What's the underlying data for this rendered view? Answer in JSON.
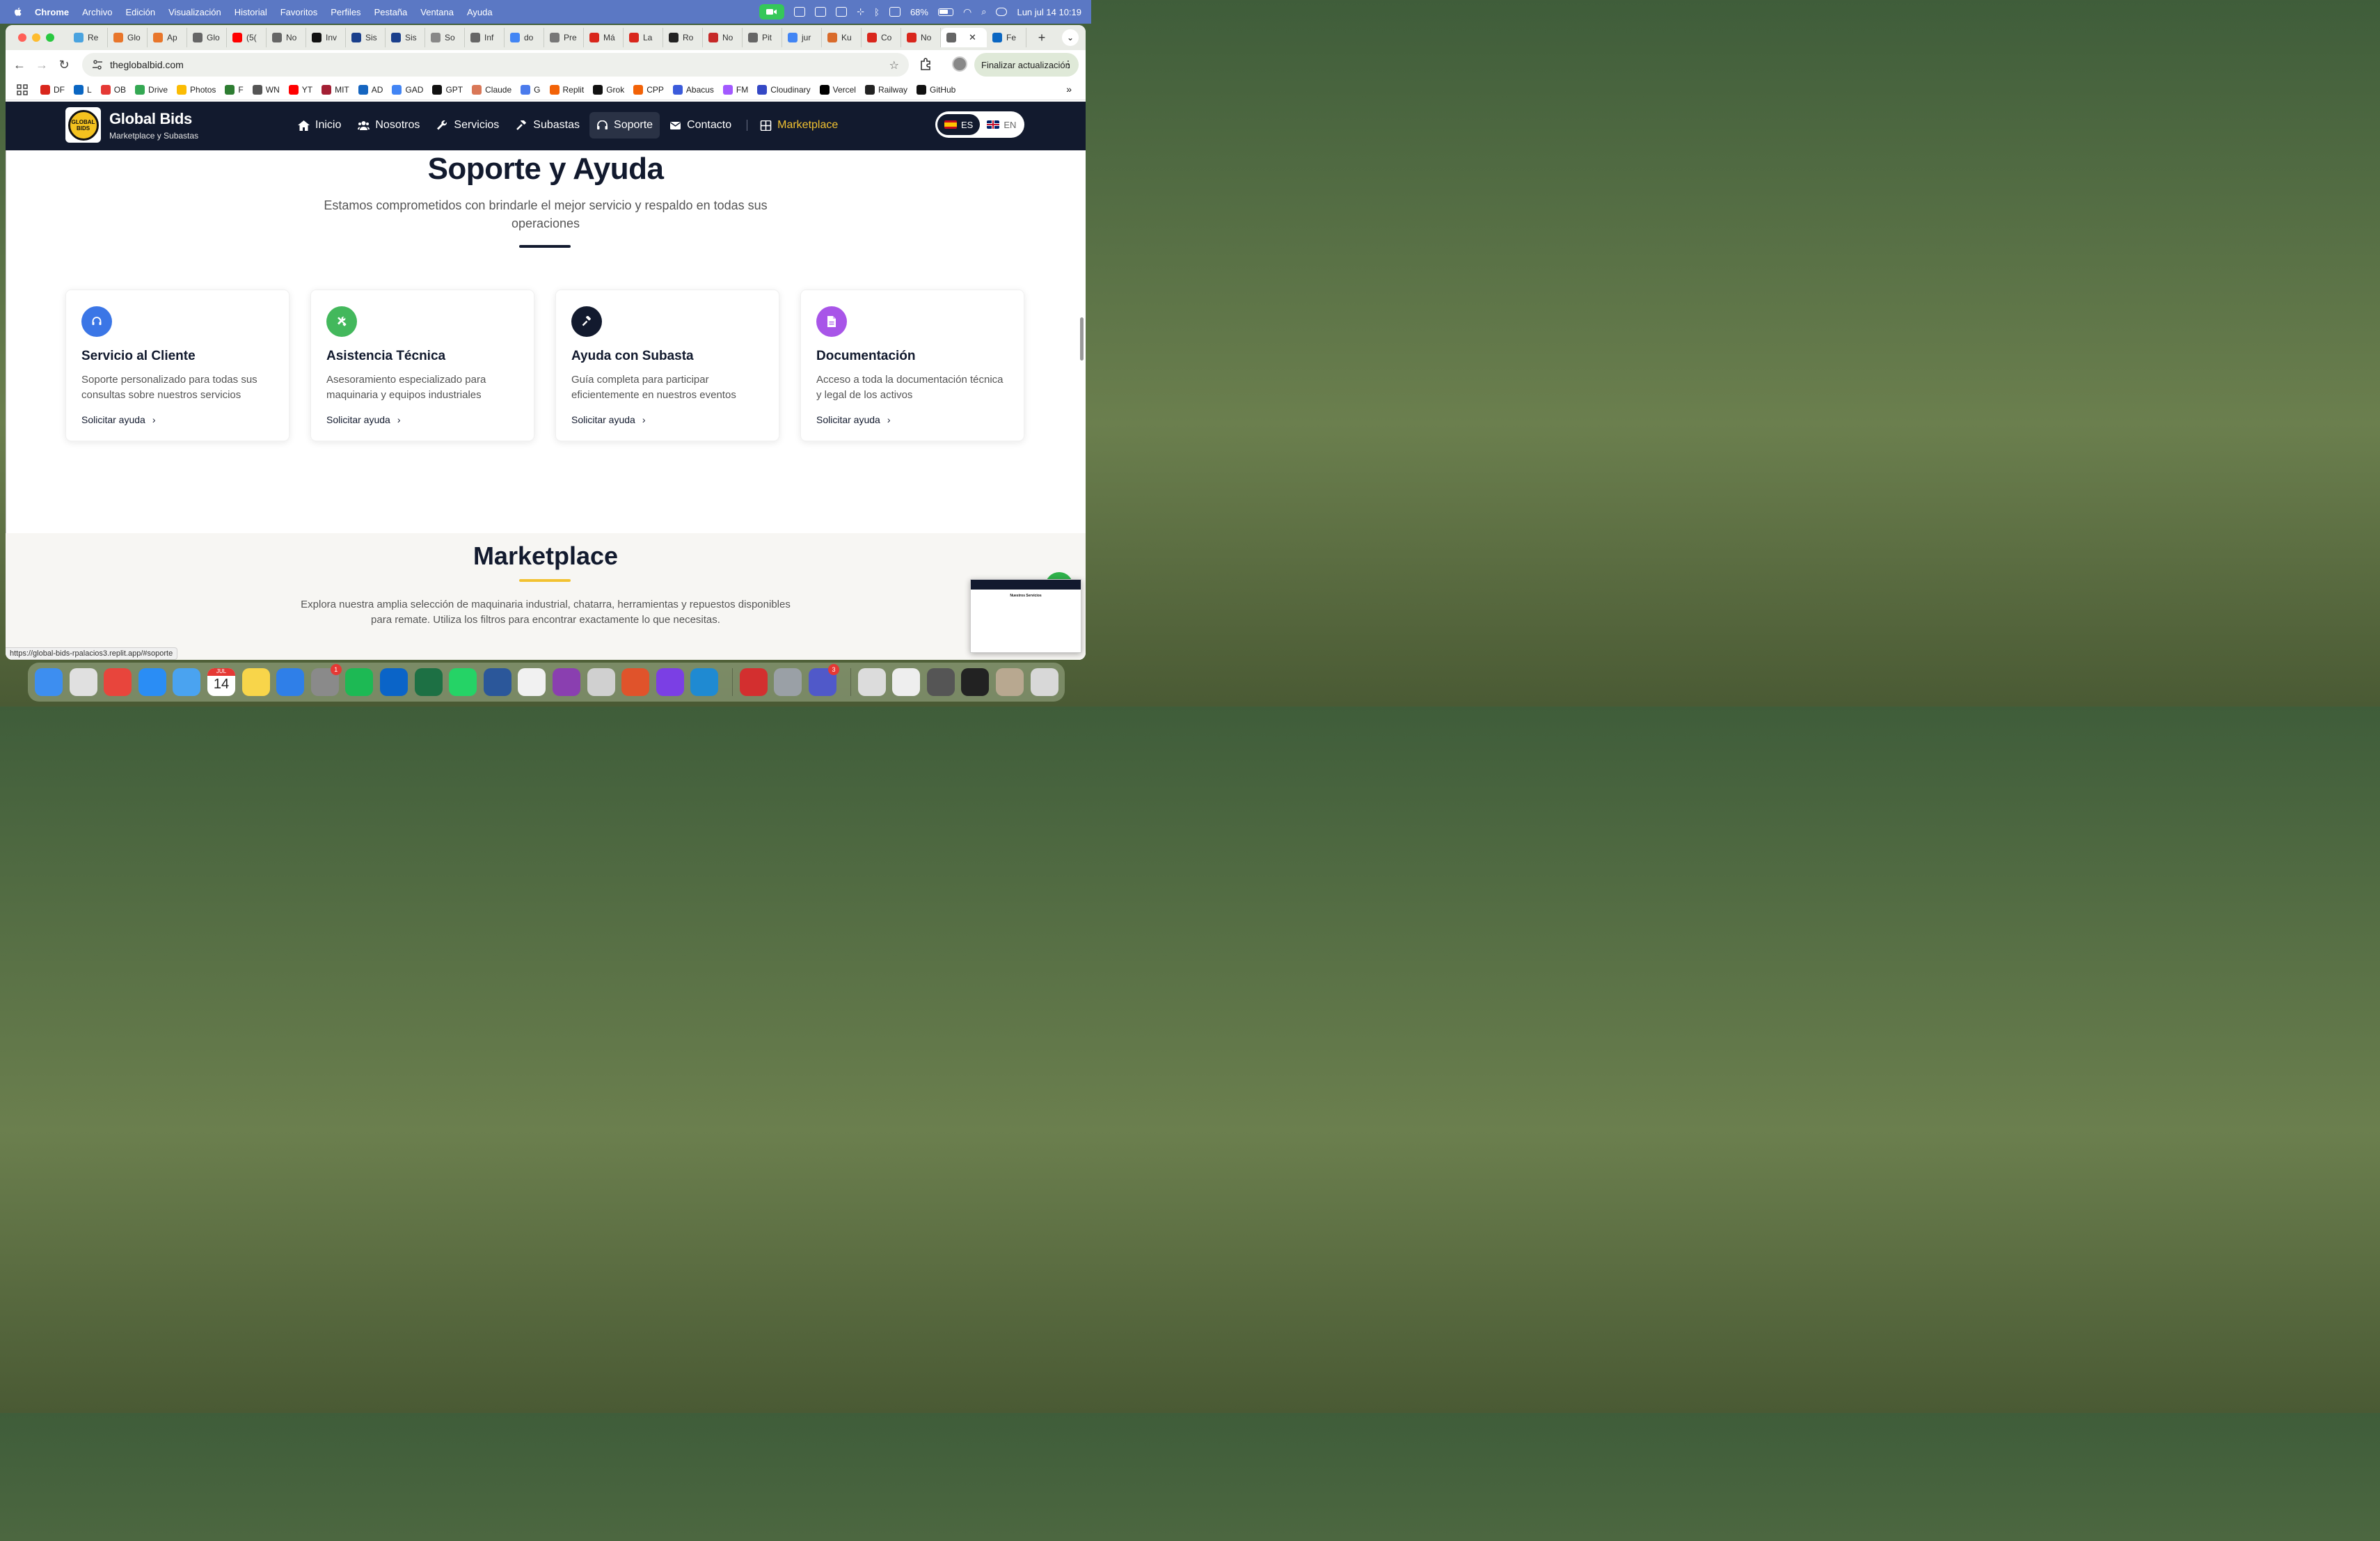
{
  "menubar": {
    "app": "Chrome",
    "items": [
      "Archivo",
      "Edición",
      "Visualización",
      "Historial",
      "Favoritos",
      "Perfiles",
      "Pestaña",
      "Ventana",
      "Ayuda"
    ],
    "battery": "68%",
    "datetime": "Lun jul 14  10:19"
  },
  "tabs": [
    {
      "label": "Re",
      "color": "#4aa3df"
    },
    {
      "label": "Glo",
      "color": "#e8762b"
    },
    {
      "label": "Ap",
      "color": "#e8762b"
    },
    {
      "label": "Glo",
      "color": "#666"
    },
    {
      "label": "(5(",
      "color": "#ff0000"
    },
    {
      "label": "No",
      "color": "#666"
    },
    {
      "label": "Inv",
      "color": "#111"
    },
    {
      "label": "Sis",
      "color": "#1a3f8c"
    },
    {
      "label": "Sis",
      "color": "#1a3f8c"
    },
    {
      "label": "So",
      "color": "#888"
    },
    {
      "label": "Inf",
      "color": "#666"
    },
    {
      "label": "do",
      "color": "#4285f4"
    },
    {
      "label": "Pre",
      "color": "#777"
    },
    {
      "label": "Má",
      "color": "#d9261c"
    },
    {
      "label": "La",
      "color": "#d9261c"
    },
    {
      "label": "Ro",
      "color": "#222"
    },
    {
      "label": "No",
      "color": "#c62828"
    },
    {
      "label": "Pit",
      "color": "#666"
    },
    {
      "label": "jur",
      "color": "#4285f4"
    },
    {
      "label": "Ku",
      "color": "#d96b2b"
    },
    {
      "label": "Co",
      "color": "#d9261c"
    },
    {
      "label": "No",
      "color": "#d9261c"
    },
    {
      "label": "",
      "color": "#666",
      "active": true
    },
    {
      "label": "Fe",
      "color": "#0a66c2"
    }
  ],
  "toolbar": {
    "url": "theglobalbid.com",
    "update_label": "Finalizar actualización"
  },
  "bookmarks": [
    {
      "label": "DF",
      "color": "#d9261c"
    },
    {
      "label": "L",
      "color": "#0a66c2"
    },
    {
      "label": "OB",
      "color": "#e53935"
    },
    {
      "label": "Drive",
      "color": "#34a853"
    },
    {
      "label": "Photos",
      "color": "#fbbc04"
    },
    {
      "label": "F",
      "color": "#2e7d32"
    },
    {
      "label": "WN",
      "color": "#555"
    },
    {
      "label": "YT",
      "color": "#ff0000"
    },
    {
      "label": "MIT",
      "color": "#a31f34"
    },
    {
      "label": "AD",
      "color": "#1565c0"
    },
    {
      "label": "GAD",
      "color": "#4285f4"
    },
    {
      "label": "GPT",
      "color": "#111"
    },
    {
      "label": "Claude",
      "color": "#d97757"
    },
    {
      "label": "G",
      "color": "#4b7bec"
    },
    {
      "label": "Replit",
      "color": "#f26207"
    },
    {
      "label": "Grok",
      "color": "#111"
    },
    {
      "label": "CPP",
      "color": "#f26207"
    },
    {
      "label": "Abacus",
      "color": "#3b5bdb"
    },
    {
      "label": "FM",
      "color": "#a259ff"
    },
    {
      "label": "Cloudinary",
      "color": "#3448c5"
    },
    {
      "label": "Vercel",
      "color": "#000"
    },
    {
      "label": "Railway",
      "color": "#222"
    },
    {
      "label": "GitHub",
      "color": "#111"
    }
  ],
  "site": {
    "logo_text": "GLOBAL BIDS",
    "brand_name": "Global Bids",
    "brand_sub": "Marketplace y Subastas",
    "nav": [
      {
        "label": "Inicio",
        "icon": "home-icon"
      },
      {
        "label": "Nosotros",
        "icon": "users-icon"
      },
      {
        "label": "Servicios",
        "icon": "wrench-icon"
      },
      {
        "label": "Subastas",
        "icon": "gavel-icon"
      },
      {
        "label": "Soporte",
        "icon": "headset-icon",
        "active": true
      },
      {
        "label": "Contacto",
        "icon": "envelope-icon"
      },
      {
        "label": "Marketplace",
        "icon": "grid-icon"
      }
    ],
    "lang": {
      "es": "ES",
      "en": "EN",
      "active": "ES"
    }
  },
  "support": {
    "title": "Soporte y Ayuda",
    "subtitle": "Estamos comprometidos con brindarle el mejor servicio y respaldo en todas sus operaciones",
    "cards": [
      {
        "title": "Servicio al Cliente",
        "desc": "Soporte personalizado para todas sus consultas sobre nuestros servicios",
        "link": "Solicitar ayuda",
        "icon": "headset-icon",
        "color": "#3b76e6"
      },
      {
        "title": "Asistencia Técnica",
        "desc": "Asesoramiento especializado para maquinaria y equipos industriales",
        "link": "Solicitar ayuda",
        "icon": "tools-icon",
        "color": "#43b85c"
      },
      {
        "title": "Ayuda con Subasta",
        "desc": "Guía completa para participar eficientemente en nuestros eventos",
        "link": "Solicitar ayuda",
        "icon": "gavel-icon",
        "color": "#121a2e"
      },
      {
        "title": "Documentación",
        "desc": "Acceso a toda la documentación técnica y legal de los activos",
        "link": "Solicitar ayuda",
        "icon": "document-icon",
        "color": "#a855e8"
      }
    ]
  },
  "marketplace": {
    "title": "Marketplace",
    "desc": "Explora nuestra amplia selección de maquinaria industrial, chatarra, herramientas y repuestos disponibles para remate. Utiliza los filtros para encontrar exactamente lo que necesitas."
  },
  "status_url": "https://global-bids-rpalacios3.replit.app/#soporte",
  "thumbnail": {
    "title": "Nuestros Servicios"
  },
  "dock": {
    "calendar_month": "JUL",
    "calendar_day": "14",
    "apps": [
      {
        "name": "finder-icon",
        "color": "#3d8ef0"
      },
      {
        "name": "launchpad-icon",
        "color": "#e0e0e0"
      },
      {
        "name": "chrome-icon",
        "color": "#e8453c"
      },
      {
        "name": "safari-icon",
        "color": "#2a8df5"
      },
      {
        "name": "mail-icon",
        "color": "#4aa3f0"
      },
      {
        "name": "calendar-icon",
        "color": "#ffffff"
      },
      {
        "name": "notes-icon",
        "color": "#f8d54a"
      },
      {
        "name": "keynote-icon",
        "color": "#2f7fe8"
      },
      {
        "name": "settings-icon",
        "color": "#8a8a8a",
        "badge": "1"
      },
      {
        "name": "spotify-icon",
        "color": "#1db954"
      },
      {
        "name": "outlook-icon",
        "color": "#0a64c8"
      },
      {
        "name": "excel-icon",
        "color": "#1d7044"
      },
      {
        "name": "whatsapp-icon",
        "color": "#25d366"
      },
      {
        "name": "word-icon",
        "color": "#2b579a"
      },
      {
        "name": "fantastical-icon",
        "color": "#f1f1f1"
      },
      {
        "name": "screen-recorder-icon",
        "color": "#8a3fb0"
      },
      {
        "name": "iphone-mirroring-icon",
        "color": "#d0d0d0"
      },
      {
        "name": "grid-app-icon",
        "color": "#e0532b"
      },
      {
        "name": "github-desktop-icon",
        "color": "#7b3fe4"
      },
      {
        "name": "vscode-icon",
        "color": "#1f8ad2"
      },
      {
        "name": "acrobat-icon",
        "color": "#d32f2f"
      },
      {
        "name": "pro-app-icon",
        "color": "#9aa0a6"
      },
      {
        "name": "teams-icon",
        "color": "#5059c9",
        "badge": "3"
      }
    ],
    "recents": [
      {
        "name": "recent-window-1",
        "color": "#dcdcdc"
      },
      {
        "name": "recent-window-2",
        "color": "#eeeeee"
      },
      {
        "name": "recent-window-3",
        "color": "#555555"
      },
      {
        "name": "recent-window-4",
        "color": "#222222"
      },
      {
        "name": "recent-window-5",
        "color": "#b8a890"
      },
      {
        "name": "trash-icon",
        "color": "#d8d8d8"
      }
    ]
  }
}
